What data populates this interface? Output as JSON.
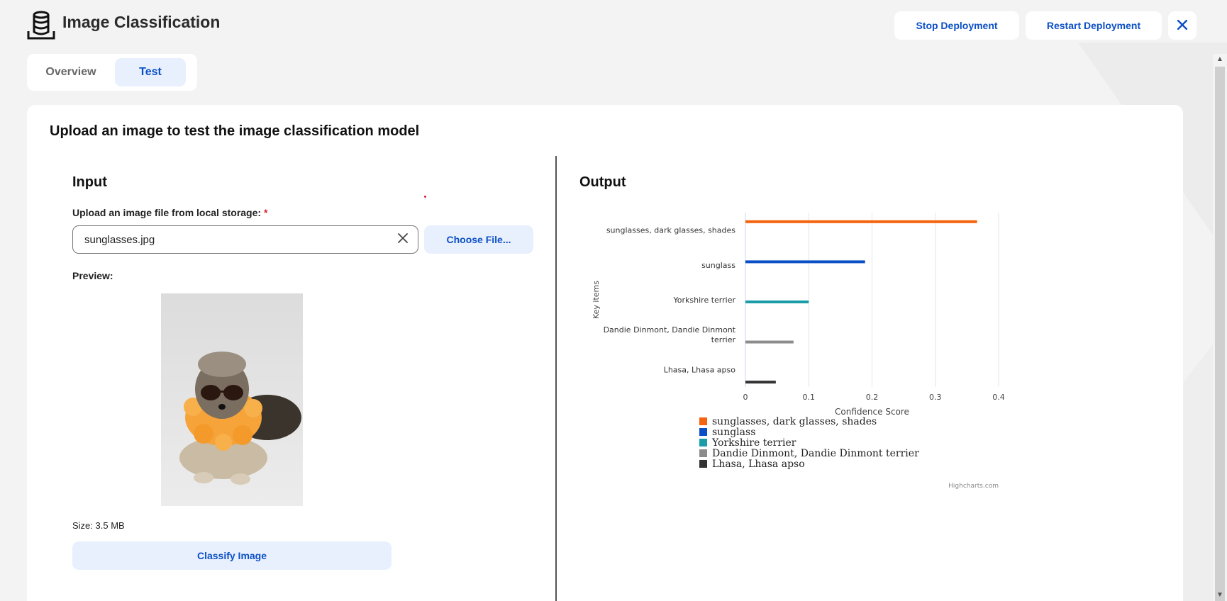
{
  "header": {
    "title": "Image Classification",
    "icon": "database-icon",
    "stop_label": "Stop Deployment",
    "restart_label": "Restart Deployment",
    "close_icon": "close-icon"
  },
  "tabs": [
    {
      "label": "Overview",
      "active": false
    },
    {
      "label": "Test",
      "active": true
    }
  ],
  "main": {
    "title": "Upload an image to test the image classification model",
    "input": {
      "heading": "Input",
      "upload_label": "Upload an image file from local storage:",
      "required_mark": "*",
      "file_value": "sunglasses.jpg",
      "choose_label": "Choose File...",
      "preview_label": "Preview:",
      "size_text": "Size: 3.5 MB",
      "classify_label": "Classify Image"
    },
    "output": {
      "heading": "Output"
    }
  },
  "colors": {
    "accent": "#0b4fc6",
    "accent_bg": "#e8f0fd",
    "required": "#d61f2c"
  },
  "chart_data": {
    "type": "bar",
    "orientation": "horizontal",
    "title": "",
    "xlabel": "Confidence Score",
    "ylabel": "Key items",
    "xlim": [
      0,
      0.4
    ],
    "xticks": [
      "0",
      "0.1",
      "0.2",
      "0.3",
      "0.4"
    ],
    "grid": true,
    "legend_position": "bottom",
    "credits": "Highcharts.com",
    "series": [
      {
        "name": "sunglasses, dark glasses, shades",
        "value": 0.366,
        "color": "#f4640f"
      },
      {
        "name": "sunglass",
        "value": 0.189,
        "color": "#0b4fc6"
      },
      {
        "name": "Yorkshire terrier",
        "value": 0.1,
        "color": "#1a9da8"
      },
      {
        "name": "Dandie Dinmont, Dandie Dinmont terrier",
        "value": 0.076,
        "color": "#8c8c8c"
      },
      {
        "name": "Lhasa, Lhasa apso",
        "value": 0.048,
        "color": "#333333"
      }
    ]
  }
}
